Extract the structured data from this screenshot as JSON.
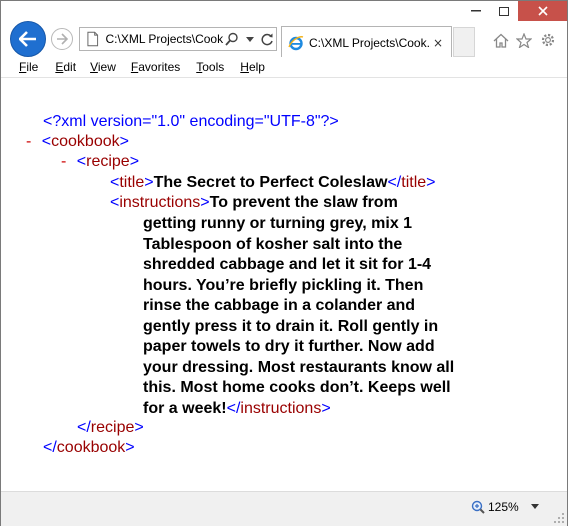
{
  "browser": {
    "address": "C:\\XML Projects\\Cook",
    "tab_title": "C:\\XML Projects\\Cook...",
    "close_tab_glyph": "×"
  },
  "menu": {
    "items": [
      {
        "underline": "F",
        "rest": "ile"
      },
      {
        "underline": "E",
        "rest": "dit"
      },
      {
        "underline": "V",
        "rest": "iew"
      },
      {
        "underline": "F",
        "rest": "avorites"
      },
      {
        "underline": "T",
        "rest": "ools"
      },
      {
        "underline": "H",
        "rest": "elp"
      }
    ]
  },
  "xml": {
    "declaration": "<?xml version=\"1.0\" encoding=\"UTF-8\"?>",
    "collapse": "-",
    "cookbook_open": "cookbook",
    "recipe_open": "recipe",
    "title_tag": "title",
    "title_text": "The Secret to Perfect Coleslaw",
    "instructions_tag": "instructions",
    "instructions_first": "To prevent the slaw from",
    "instructions_lines": [
      "getting runny or turning grey, mix 1",
      "Tablespoon of kosher salt into the",
      "shredded cabbage and let it sit for 1-4",
      "hours. You’re briefly pickling it. Then",
      "rinse the cabbage in a colander and",
      "gently press it to drain it. Roll gently in",
      "paper towels to dry it further. Now add",
      "your dressing. Most restaurants know all",
      "this. Most home cooks don’t. Keeps well"
    ],
    "instructions_last": "for a week!",
    "recipe_close": "recipe",
    "cookbook_close": "cookbook"
  },
  "status": {
    "zoom": "125%"
  },
  "colors": {
    "tag_blue": "#0000ff",
    "tag_name": "#990000",
    "collapse_red": "#cc0000",
    "back_button": "#1f6fd0",
    "close_button": "#c7514a"
  }
}
